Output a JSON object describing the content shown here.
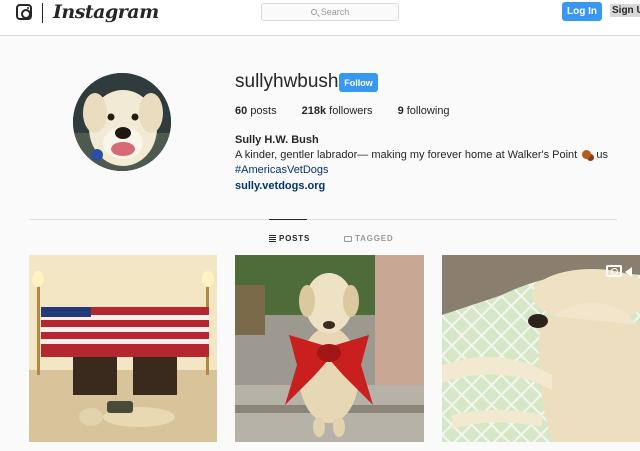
{
  "header": {
    "wordmark": "Instagram",
    "search_placeholder": "Search",
    "login_label": "Log In",
    "signup_label": "Sign Up"
  },
  "profile": {
    "username": "sullyhwbush",
    "follow_label": "Follow",
    "stats": {
      "posts_count": "60",
      "posts_label": "posts",
      "followers_count": "218k",
      "followers_label": "followers",
      "following_count": "9",
      "following_label": "following"
    },
    "full_name": "Sully H.W. Bush",
    "bio_text": "A kinder, gentler labrador— making my forever home at Walker's Point",
    "bio_suffix": "us",
    "hashtag": "#AmericasVetDogs",
    "website": "sully.vetdogs.org"
  },
  "tabs": {
    "posts_label": "POSTS",
    "tagged_label": "TAGGED"
  },
  "colors": {
    "accent": "#3897f0",
    "link": "#003569",
    "border": "#dbdbdb"
  }
}
